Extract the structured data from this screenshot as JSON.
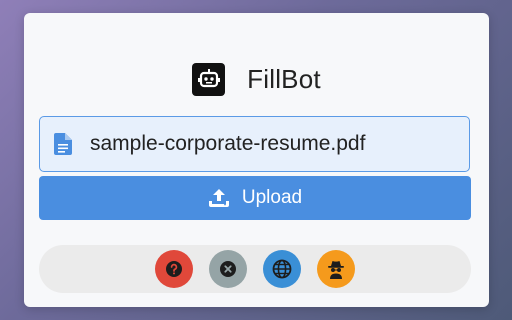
{
  "app": {
    "title": "FillBot",
    "logo_icon": "robot-icon"
  },
  "file": {
    "icon": "document-icon",
    "name": "sample-corporate-resume.pdf"
  },
  "upload": {
    "label": "Upload",
    "icon": "upload-icon",
    "color": "#4a8ee0"
  },
  "actions": [
    {
      "name": "help",
      "icon": "question-icon",
      "color": "#e0483a"
    },
    {
      "name": "clear",
      "icon": "close-icon",
      "color": "#95a4a6"
    },
    {
      "name": "language",
      "icon": "globe-icon",
      "color": "#3a8fd6"
    },
    {
      "name": "privacy",
      "icon": "spy-icon",
      "color": "#f59a1c"
    }
  ]
}
